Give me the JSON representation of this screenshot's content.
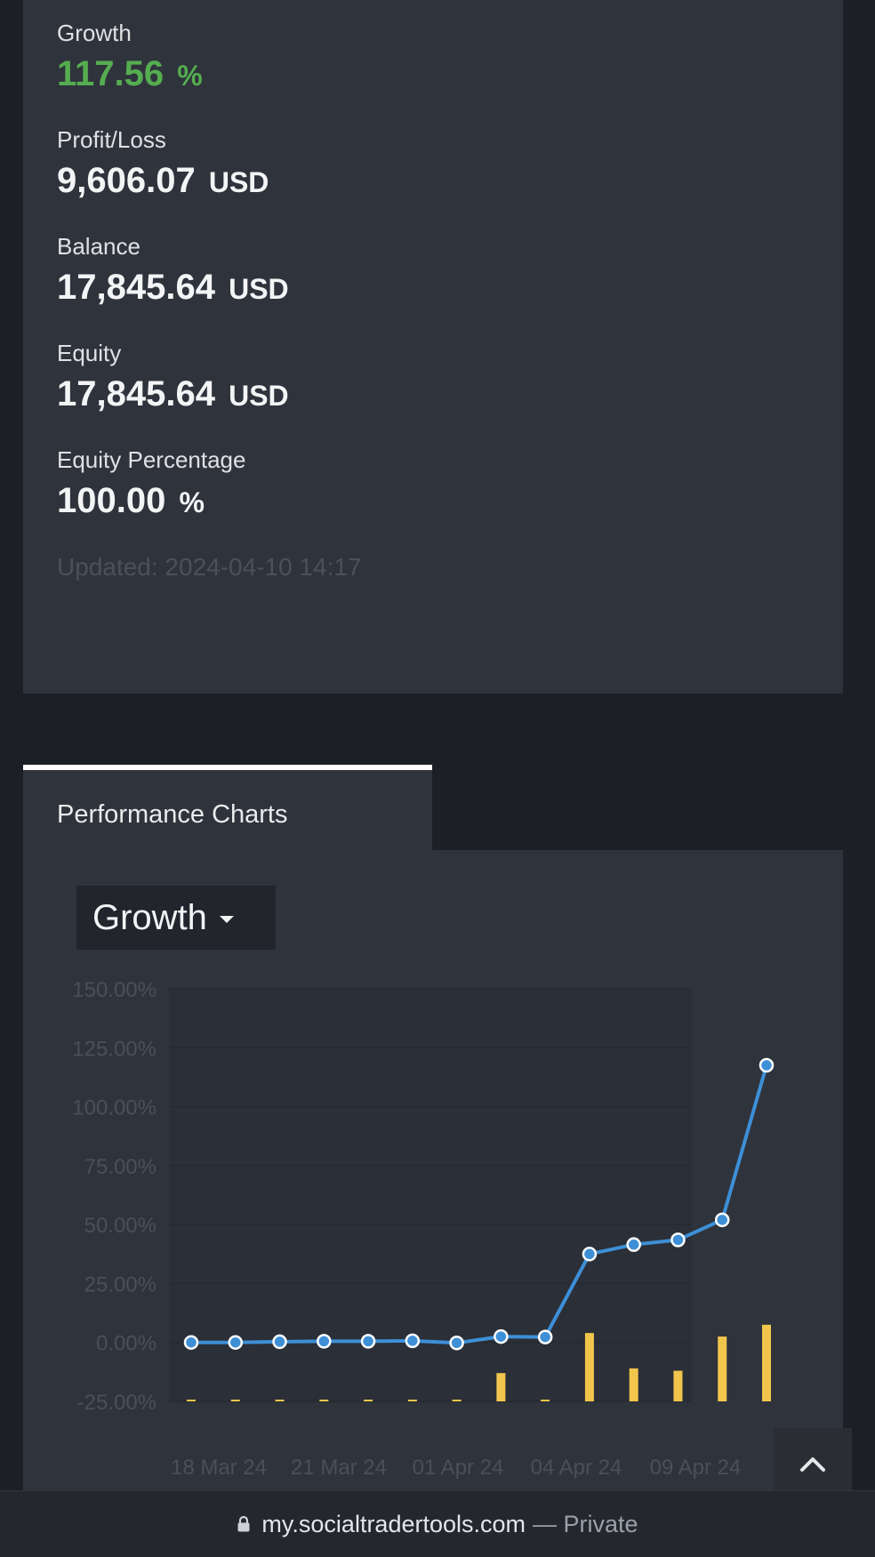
{
  "stats": [
    {
      "label": "Growth",
      "value": "117.56",
      "unit": "%"
    },
    {
      "label": "Profit/Loss",
      "value": "9,606.07",
      "unit": "USD"
    },
    {
      "label": "Balance",
      "value": "17,845.64",
      "unit": "USD"
    },
    {
      "label": "Equity",
      "value": "17,845.64",
      "unit": "USD"
    },
    {
      "label": "Equity Percentage",
      "value": "100.00",
      "unit": "%"
    }
  ],
  "updated": "Updated: 2024-04-10 14:17",
  "tab_label": "Performance Charts",
  "dropdown_label": "Growth",
  "browser": {
    "domain": "my.socialtradertools.com",
    "privacy": "— Private"
  },
  "colors": {
    "growth_green": "#55ad50",
    "line": "#3d8fd6",
    "bars": "#f2c64c",
    "card": "#2f333c",
    "page": "#1c1f26"
  },
  "chart_data": {
    "type": "line",
    "y_ticks": [
      "150.00%",
      "125.00%",
      "100.00%",
      "75.00%",
      "50.00%",
      "25.00%",
      "0.00%",
      "-25.00%"
    ],
    "ylim": [
      -25,
      150
    ],
    "x_tick_labels": [
      "18 Mar 24",
      "21 Mar 24",
      "01 Apr 24",
      "04 Apr 24",
      "09 Apr 24"
    ],
    "grid": true,
    "series": [
      {
        "type": "line",
        "values": [
          0.0,
          0.0,
          0.3,
          0.5,
          0.5,
          0.7,
          -0.2,
          2.5,
          2.3,
          37.5,
          41.5,
          43.5,
          52.0,
          117.56
        ]
      },
      {
        "type": "bar",
        "values": [
          0.3,
          0.3,
          0.3,
          0.3,
          0.3,
          0.3,
          0.5,
          12.0,
          0.5,
          29.0,
          14.0,
          13.0,
          27.5,
          32.5
        ]
      }
    ]
  }
}
